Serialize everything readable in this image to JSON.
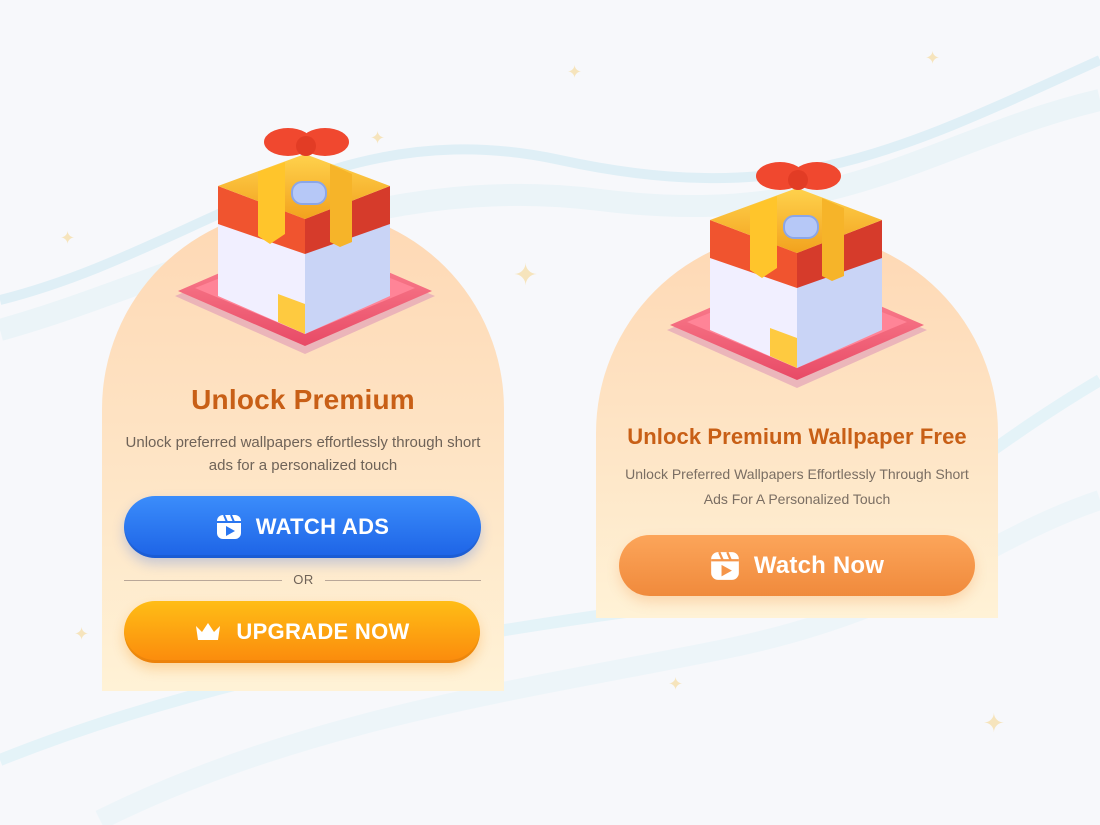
{
  "cards": [
    {
      "title": "Unlock Premium",
      "description": "Unlock preferred wallpapers effortlessly through short ads for a personalized touch",
      "primary_button": {
        "label": "WATCH ADS",
        "icon": "play-video-icon",
        "color": "#2a76f0"
      },
      "divider_label": "OR",
      "secondary_button": {
        "label": "UPGRADE NOW",
        "icon": "crown-icon",
        "color": "#fda20f"
      }
    },
    {
      "title": "Unlock Premium Wallpaper Free",
      "description": "Unlock Preferred Wallpapers Effortlessly Through Short Ads For A Personalized Touch",
      "primary_button": {
        "label": "Watch Now",
        "icon": "play-video-icon",
        "color": "#f5954a"
      }
    }
  ],
  "colors": {
    "title": "#c85f16",
    "card_background_top": "#fed8b4",
    "card_background_bottom": "#fff2d6",
    "page_background": "#f7f8fb"
  }
}
